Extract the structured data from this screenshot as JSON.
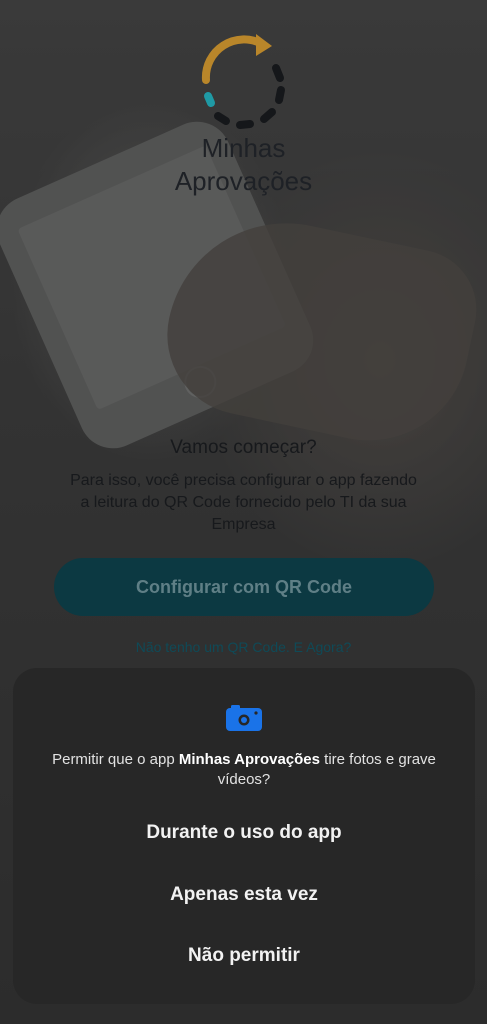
{
  "app": {
    "name_line1": "Minhas",
    "name_line2": "Aprovações"
  },
  "welcome": {
    "title": "Vamos começar?",
    "text": "Para isso, você precisa configurar o app fazendo a leitura do QR Code fornecido pelo TI da sua Empresa",
    "qr_button_label": "Configurar com QR Code",
    "no_qr_link": "Não tenho um QR Code. E Agora?"
  },
  "permission_dialog": {
    "icon": "camera-icon",
    "prompt_prefix": "Permitir que o app ",
    "prompt_app": "Minhas Aprovações",
    "prompt_suffix": " tire fotos e grave vídeos?",
    "options": [
      "Durante o uso do app",
      "Apenas esta vez",
      "Não permitir"
    ]
  },
  "colors": {
    "logo_orange": "#b9862a",
    "logo_teal": "#1f9aa5",
    "button_bg": "#0c3942",
    "dialog_bg": "#272727",
    "camera_blue": "#1a73e8"
  }
}
